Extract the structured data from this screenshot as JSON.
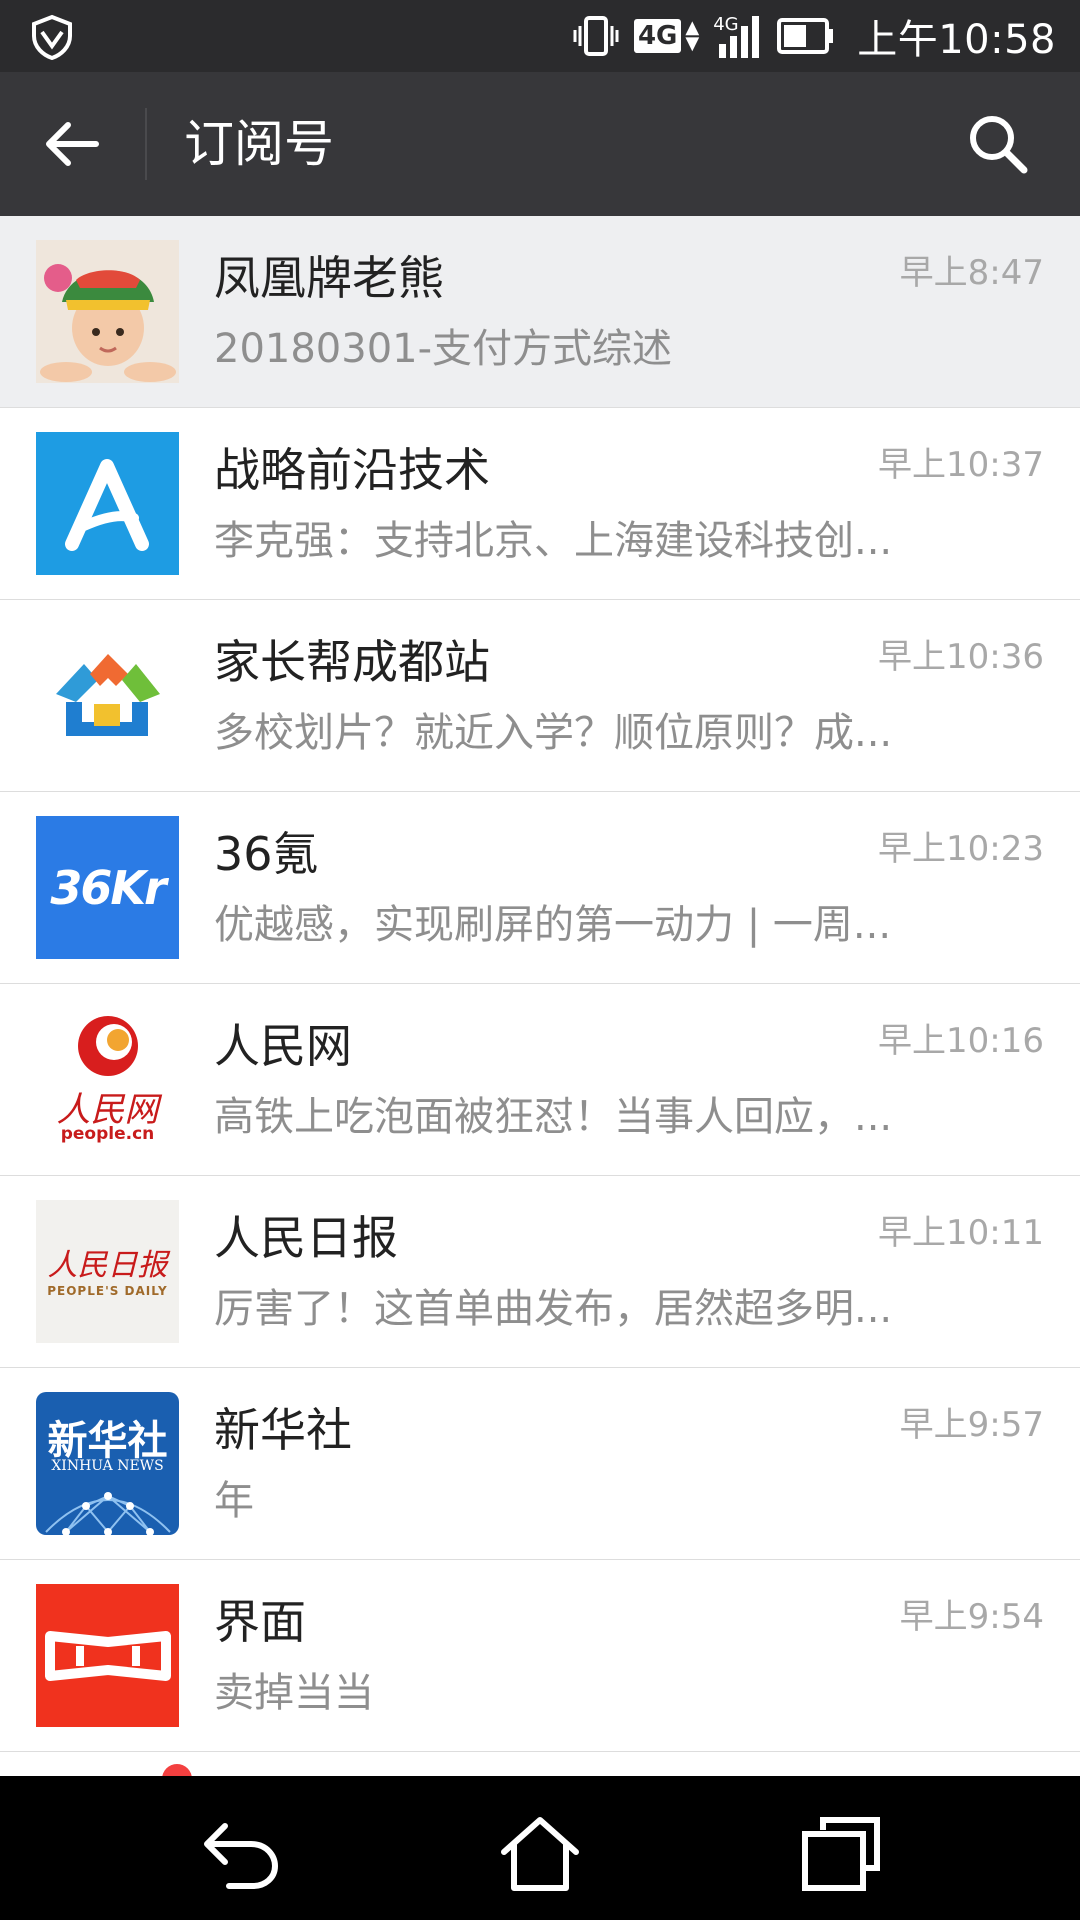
{
  "status_bar": {
    "network_badge": "4G",
    "signal_label": "4G",
    "time": "上午10:58"
  },
  "title_bar": {
    "title": "订阅号"
  },
  "subscriptions": [
    {
      "name": "凤凰牌老熊",
      "time": "早上8:47",
      "preview": "20180301-支付方式综述",
      "avatar": "baby-photo-avatar"
    },
    {
      "name": "战略前沿技术",
      "time": "早上10:37",
      "preview": "李克强：支持北京、上海建设科技创...",
      "avatar": "blue-a-logo"
    },
    {
      "name": "家长帮成都站",
      "time": "早上10:36",
      "preview": "多校划片？就近入学？顺位原则？成...",
      "avatar": "colorful-house-logo"
    },
    {
      "name": "36氪",
      "time": "早上10:23",
      "preview": "优越感，实现刷屏的第一动力 | 一周...",
      "avatar": "36kr-logo",
      "logo_text": "36Kr"
    },
    {
      "name": "人民网",
      "time": "早上10:16",
      "preview": "高铁上吃泡面被狂怼！当事人回应，...",
      "avatar": "people-cn-logo",
      "logo_text": "人民网",
      "logo_sub": "people.cn"
    },
    {
      "name": "人民日报",
      "time": "早上10:11",
      "preview": "厉害了！这首单曲发布，居然超多明...",
      "avatar": "peoples-daily-logo",
      "logo_text": "人民日报",
      "logo_sub": "PEOPLE'S DAILY"
    },
    {
      "name": "新华社",
      "time": "早上9:57",
      "preview": "年",
      "avatar": "xinhua-logo",
      "logo_text": "新华社",
      "logo_sub": "XINHUA NEWS"
    },
    {
      "name": "界面",
      "time": "早上9:54",
      "preview": "卖掉当当",
      "avatar": "jiemian-logo"
    }
  ],
  "colors": {
    "status_bar_bg": "#2b2b2d",
    "title_bar_bg": "#37373a",
    "highlight_row_bg": "#eeeff1",
    "time_text": "#a8a8a8",
    "preview_text": "#8e8e8e",
    "unread_dot": "#f34040"
  }
}
